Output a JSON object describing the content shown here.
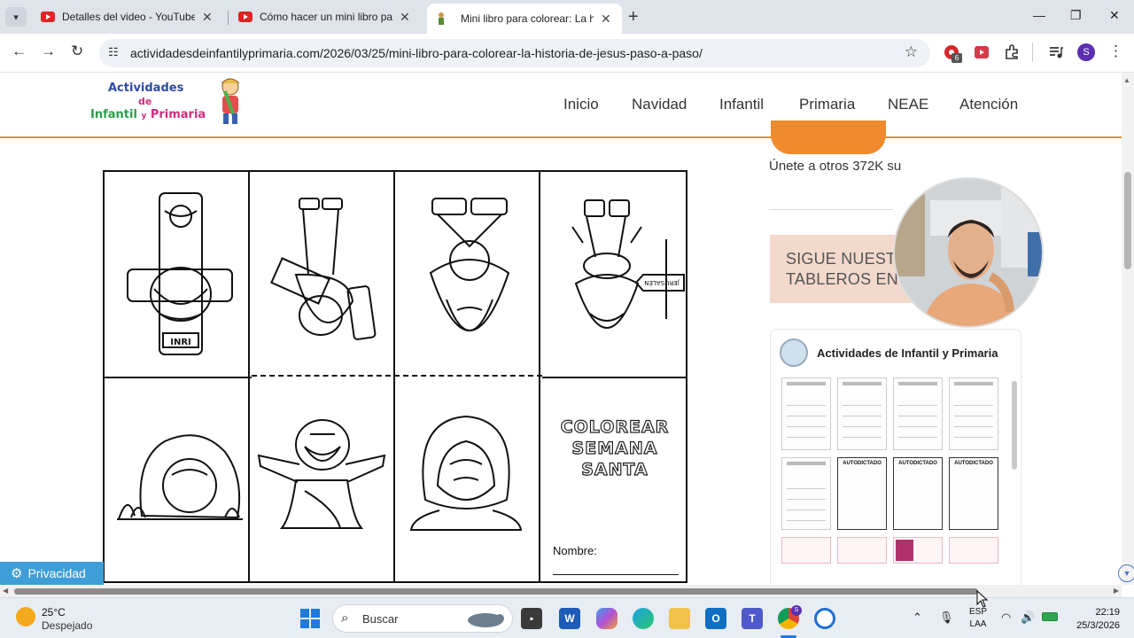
{
  "browser": {
    "tabs": [
      {
        "title": "Detalles del video - YouTube St",
        "favicon": "youtube-icon"
      },
      {
        "title": "Cómo hacer un mini libro para",
        "favicon": "youtube-icon"
      },
      {
        "title": "Mini libro para colorear: La histo",
        "favicon": "site-favicon"
      }
    ],
    "url": "actividadesdeinfantilyprimaria.com/2026/03/25/mini-libro-para-colorear-la-historia-de-jesus-paso-a-paso/",
    "extension_badge": "6",
    "profile_initial": "S"
  },
  "site": {
    "logo": {
      "line1": "Actividades",
      "line2": "de",
      "line3a": "Infantil",
      "line3b": "y",
      "line3c": "Primaria"
    },
    "nav": [
      "Inicio",
      "Navidad",
      "Infantil",
      "Primaria",
      "NEAE",
      "Atención"
    ],
    "sheet": {
      "cover_title_lines": [
        "COLOREAR",
        "SEMANA",
        "SANTA"
      ],
      "name_label": "Nombre:",
      "sign_text": "JERUSALÉN",
      "inri_text": "INRI"
    },
    "sidebar": {
      "join_text": "Únete a otros 372K su",
      "pinterest_box": "SIGUE NUESTROS TABLEROS EN PINTEREST",
      "widget_title": "Actividades de Infantil y Primaria",
      "pin_label": "AUTODICTADO"
    },
    "privacy_label": "Privacidad"
  },
  "taskbar": {
    "temperature": "25°C",
    "weather": "Despejado",
    "search_placeholder": "Buscar",
    "lang_line1": "ESP",
    "lang_line2": "LAA",
    "time": "22:19",
    "date": "25/3/2026",
    "chrome_badge": "S"
  },
  "colors": {
    "accent_orange": "#ef8b2c",
    "pinterest_box_bg": "#f2d9cc",
    "privacy_blue": "#3d9ed8"
  }
}
